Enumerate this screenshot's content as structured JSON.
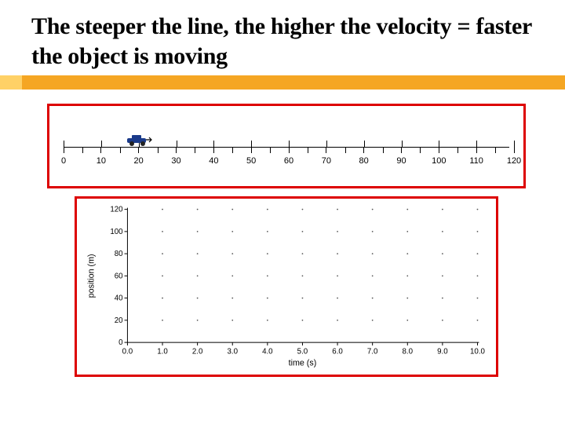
{
  "title": "The steeper the line, the higher the velocity = faster the object is moving",
  "ruler": {
    "min": 0,
    "max": 120,
    "step": 10,
    "car_position": 20,
    "labels": [
      "0",
      "10",
      "20",
      "30",
      "40",
      "50",
      "60",
      "70",
      "80",
      "90",
      "100",
      "110",
      "120"
    ]
  },
  "chart_data": {
    "type": "scatter",
    "title": "",
    "xlabel": "time (s)",
    "ylabel": "position (m)",
    "xlim": [
      0,
      10
    ],
    "ylim": [
      0,
      120
    ],
    "x_ticks": [
      0.0,
      1.0,
      2.0,
      3.0,
      4.0,
      5.0,
      6.0,
      7.0,
      8.0,
      9.0,
      10.0
    ],
    "y_ticks": [
      0,
      20,
      40,
      60,
      80,
      100,
      120
    ],
    "x_tick_labels": [
      "0.0",
      "1.0",
      "2.0",
      "3.0",
      "4.0",
      "5.0",
      "6.0",
      "7.0",
      "8.0",
      "9.0",
      "10.0"
    ],
    "y_tick_labels": [
      "0",
      "20",
      "40",
      "60",
      "80",
      "100",
      "120"
    ],
    "grid": true,
    "series": []
  }
}
